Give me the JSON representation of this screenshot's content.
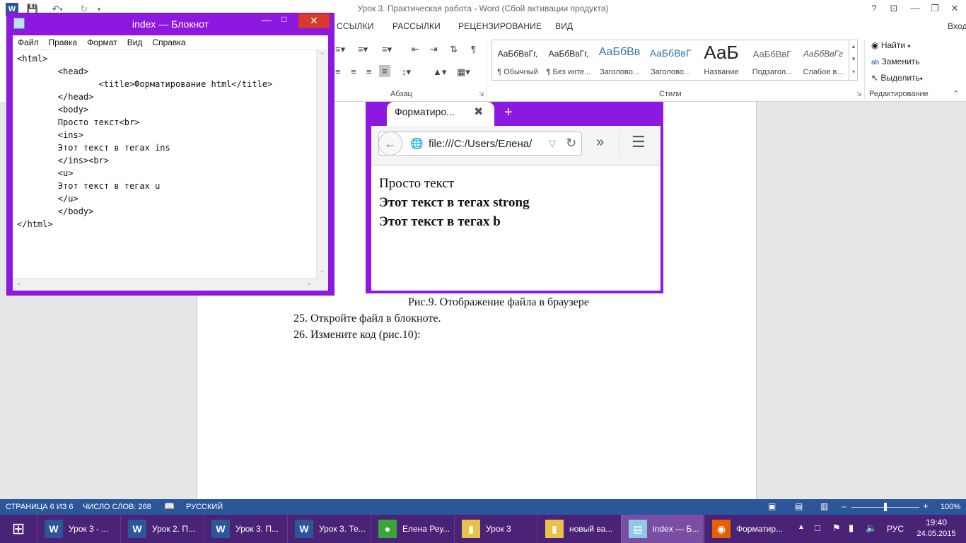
{
  "word": {
    "window_title": "Урок 3. Практическая работа - Word (Сбой активации продукта)",
    "login": "Вход",
    "window_controls": {
      "help": "?",
      "restore_ribbon": "⊡",
      "minimize": "—",
      "maximize": "❐",
      "close": "✕"
    },
    "tabs": [
      "ССЫЛКИ",
      "РАССЫЛКИ",
      "РЕЦЕНЗИРОВАНИЕ",
      "ВИД"
    ],
    "groups": {
      "paragraph": "Абзац",
      "styles": "Стили",
      "editing": "Редактирование"
    },
    "styles": [
      {
        "preview": "АаБбВвГг,",
        "name": "¶ Обычный"
      },
      {
        "preview": "АаБбВвГг,",
        "name": "¶ Без инте..."
      },
      {
        "preview": "АаБбВв",
        "name": "Заголово..."
      },
      {
        "preview": "АаБбВвГ",
        "name": "Заголово..."
      },
      {
        "preview": "АаБ",
        "name": "Название"
      },
      {
        "preview": "АаБбВвГ",
        "name": "Подзагол..."
      },
      {
        "preview": "АаБбВвГг",
        "name": "Слабое в..."
      }
    ],
    "editing": {
      "find": "Найти",
      "replace": "Заменить",
      "select": "Выделить"
    },
    "document": {
      "caption": "Рис.9. Отображение файла в браузере",
      "step25": "25. Откройте файл в блокноте.",
      "step26": "26. Измените код (рис.10):"
    },
    "statusbar": {
      "page": "СТРАНИЦА 6 ИЗ 6",
      "words": "ЧИСЛО СЛОВ: 268",
      "language": "РУССКИЙ",
      "zoom": "100%"
    }
  },
  "notepad": {
    "title": "index — Блокнот",
    "menu": [
      "Файл",
      "Правка",
      "Формат",
      "Вид",
      "Справка"
    ],
    "content": "<html>\n        <head>\n                <title>Форматирование html</title>\n        </head>\n        <body>\n        Просто текст<br>\n        <ins>\n        Этот текст в тегах ins\n        </ins><br>\n        <u>\n        Этот текст в тегах u\n        </u>\n        </body>\n</html>"
  },
  "browser": {
    "tab_title": "Форматиро...",
    "url": "file:///C:/Users/Елена/",
    "lines": [
      "Просто текст",
      "Этот текст в тегах strong",
      "Этот текст в тегах b"
    ]
  },
  "taskbar": {
    "items": [
      {
        "label": "Урок 3 - ...",
        "icon": "word-icon",
        "color": "#2b579a"
      },
      {
        "label": "Урок 2. П...",
        "icon": "word-icon",
        "color": "#2b579a"
      },
      {
        "label": "Урок 3. П...",
        "icon": "word-icon",
        "color": "#2b579a"
      },
      {
        "label": "Урок 3. Те...",
        "icon": "word-icon",
        "color": "#2b579a"
      },
      {
        "label": "Елена Реу...",
        "icon": "chrome-icon",
        "color": "#3ba53b"
      },
      {
        "label": "Урок 3",
        "icon": "folder-icon",
        "color": "#e8c04a"
      },
      {
        "label": "новый ва...",
        "icon": "folder-icon",
        "color": "#e8c04a"
      },
      {
        "label": "index — Б...",
        "icon": "notepad-icon",
        "color": "#8ecae6"
      },
      {
        "label": "Форматир...",
        "icon": "firefox-icon",
        "color": "#e66000"
      }
    ],
    "language": "РУС",
    "time": "19:40",
    "date": "24.05.2015"
  }
}
